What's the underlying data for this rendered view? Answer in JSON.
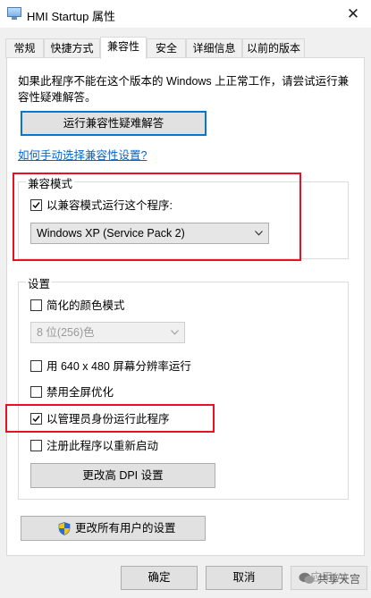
{
  "window": {
    "title": "HMI Startup 属性",
    "close_glyph": "✕"
  },
  "tabs": [
    {
      "label": "常规"
    },
    {
      "label": "快捷方式"
    },
    {
      "label": "兼容性"
    },
    {
      "label": "安全"
    },
    {
      "label": "详细信息"
    },
    {
      "label": "以前的版本"
    }
  ],
  "active_tab": "兼容性",
  "compat": {
    "description": "如果此程序不能在这个版本的 Windows 上正常工作，请尝试运行兼容性疑难解答。",
    "troubleshoot_button": "运行兼容性疑难解答",
    "manual_link": "如何手动选择兼容性设置?",
    "mode_group": {
      "label": "兼容模式",
      "checkbox_label": "以兼容模式运行这个程序:",
      "checked": true,
      "selected_os": "Windows XP (Service Pack 2)"
    },
    "settings_group": {
      "label": "设置",
      "reduced_color": {
        "label": "简化的颜色模式",
        "checked": false
      },
      "color_select": "8 位(256)色",
      "res_640": {
        "label": "用 640 x 480 屏幕分辨率运行",
        "checked": false
      },
      "disable_fullscreen": {
        "label": "禁用全屏优化",
        "checked": false
      },
      "run_as_admin": {
        "label": "以管理员身份运行此程序",
        "checked": true
      },
      "register_restart": {
        "label": "注册此程序以重新启动",
        "checked": false
      },
      "dpi_button": "更改高 DPI 设置"
    },
    "all_users_button": "更改所有用户的设置"
  },
  "footer": {
    "ok": "确定",
    "cancel": "取消",
    "apply": "应用(A)"
  },
  "watermark": "共享天宫",
  "colors": {
    "accent": "#0078d7",
    "highlight_box": "#e81123",
    "link": "#0066cc"
  }
}
